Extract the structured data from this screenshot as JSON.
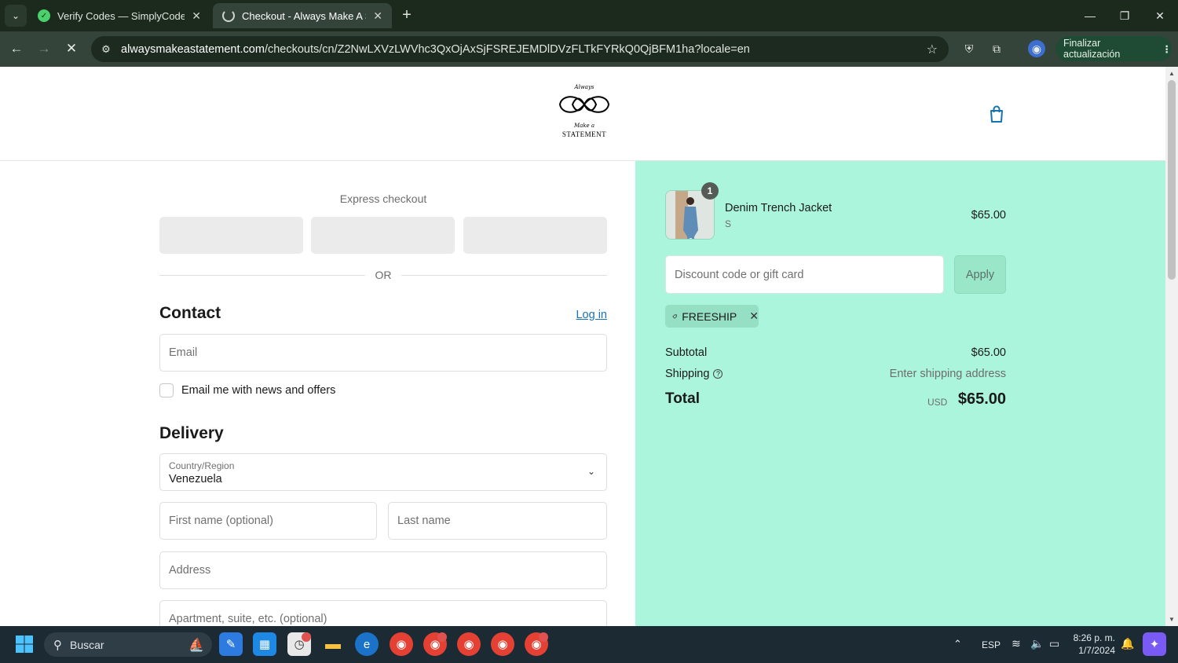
{
  "browser": {
    "tabs": [
      {
        "title": "Verify Codes — SimplyCodes",
        "favicon": "simplycodes-icon",
        "active": false
      },
      {
        "title": "Checkout - Always Make A Stat",
        "favicon": "loading-spinner-icon",
        "active": true
      }
    ],
    "url_domain": "alwaysmakeastatement.com",
    "url_path": "/checkouts/cn/Z2NwLXVzLWVhc3QxOjAxSjFSREJEMDlDVzFLTkFYRkQ0QjBFM1ha?locale=en",
    "update_button": "Finalizar actualización"
  },
  "store": {
    "logo_top": "Always",
    "logo_middle": "Make a",
    "logo_wordmark": "STATEMENT"
  },
  "checkout": {
    "express_label": "Express checkout",
    "or_label": "OR",
    "contact_heading": "Contact",
    "login_link": "Log in",
    "email_placeholder": "Email",
    "newsletter_label": "Email me with news and offers",
    "delivery_heading": "Delivery",
    "country_label": "Country/Region",
    "country_value": "Venezuela",
    "first_name_placeholder": "First name (optional)",
    "last_name_placeholder": "Last name",
    "address_placeholder": "Address",
    "apartment_placeholder": "Apartment, suite, etc. (optional)"
  },
  "summary": {
    "item": {
      "name": "Denim Trench Jacket",
      "variant": "S",
      "price": "$65.00",
      "quantity": "1"
    },
    "discount_placeholder": "Discount code or gift card",
    "apply_label": "Apply",
    "applied_code": "FREESHIP",
    "subtotal_label": "Subtotal",
    "subtotal_value": "$65.00",
    "shipping_label": "Shipping",
    "shipping_value": "Enter shipping address",
    "total_label": "Total",
    "total_currency": "USD",
    "total_value": "$65.00",
    "accent_color": "#abf5dc"
  },
  "taskbar": {
    "search_label": "Buscar",
    "language": "ESP",
    "time": "8:26 p. m.",
    "date": "1/7/2024"
  }
}
